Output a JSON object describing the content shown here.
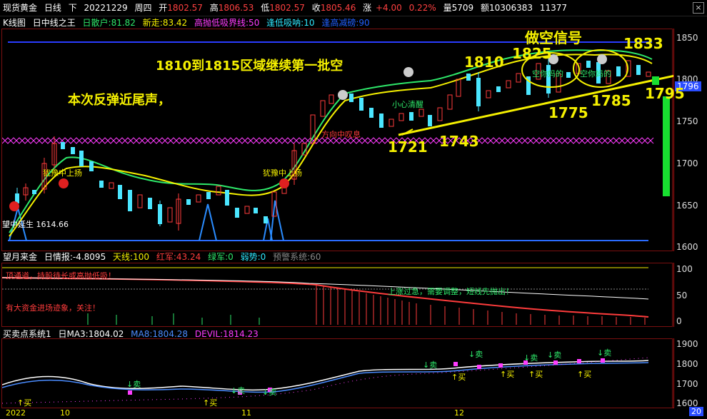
{
  "header": {
    "symbol": "现货黄金",
    "period": "日线",
    "dir": "下",
    "date": "20221229",
    "weekday": "周四",
    "open_label": "开",
    "open": "1802.57",
    "high_label": "高",
    "high": "1806.53",
    "low_label": "低",
    "low": "1802.57",
    "close_label": "收",
    "close": "1805.46",
    "change_label": "涨",
    "change": "+4.00",
    "change_pct": "0.22%",
    "volume": "量5709",
    "amount": "额10306383",
    "extra": "11377"
  },
  "main_indicator": {
    "title": "K线图",
    "name": "日中线之王",
    "sanhu": "日散户:81.82",
    "xinzou": "新走:83.42",
    "gaopao": "高抛低吸界线:50",
    "feng_di": "逢低吸呐:10",
    "feng_gao": "逢高减磅:90"
  },
  "annotations": {
    "title1": "1810到1815区域继续第一批空",
    "title2": "本次反弹近尾声，",
    "signal": "做空信号",
    "lv1833": "1833",
    "lv1825": "1825",
    "lv1810": "1810",
    "lv1795": "1795",
    "lv1775": "1775",
    "lv1785": "1785",
    "lv1721": "1721",
    "lv1743": "1743",
    "careful": "小心清醒",
    "hesitate1": "犹豫中上扬",
    "hesitate2": "犹豫中上扬",
    "mid_rise": "望中延生",
    "mid_val": "1614.66",
    "kong1": "空你妈的",
    "kong2": "空你妈的",
    "close_tag": "1796",
    "gold_cross": "方向中叹息",
    "mid_top_val": "1833"
  },
  "price_axis": [
    "1850",
    "1800",
    "1750",
    "1700",
    "1650",
    "1600"
  ],
  "sub1": {
    "title": "望月来金",
    "info": "日情报:-4.8095",
    "tian": "天线:100",
    "hong": "红军:43.24",
    "lv": "绿军:0",
    "ruo": "弱势:0",
    "warn": "预警系统:60",
    "note1": "顶通道，持股待长或高抛低吸！",
    "note2": "有大资金进场迹象，关注！",
    "note3": "上涨过急，需要调整，短线先抛出！",
    "axis": [
      "100",
      "50",
      "0"
    ]
  },
  "sub2": {
    "title": "买卖点系统1",
    "ma3": "日MA3:1804.02",
    "ma8": "MA8:1804.28",
    "devil": "DEVIL:1814.23",
    "sell": "↓卖",
    "buy": "↑买",
    "axis": [
      "1900",
      "1800",
      "1700",
      "1600"
    ]
  },
  "time_axis": [
    "2022",
    "10",
    "11",
    "12",
    "20"
  ],
  "colors": {
    "up": "#ff3c3c",
    "down": "#4be6ff",
    "ma_yellow": "#f5f000",
    "ma_green": "#2ee86a",
    "blue_line": "#2060ff",
    "magenta": "#ff3cff"
  }
}
